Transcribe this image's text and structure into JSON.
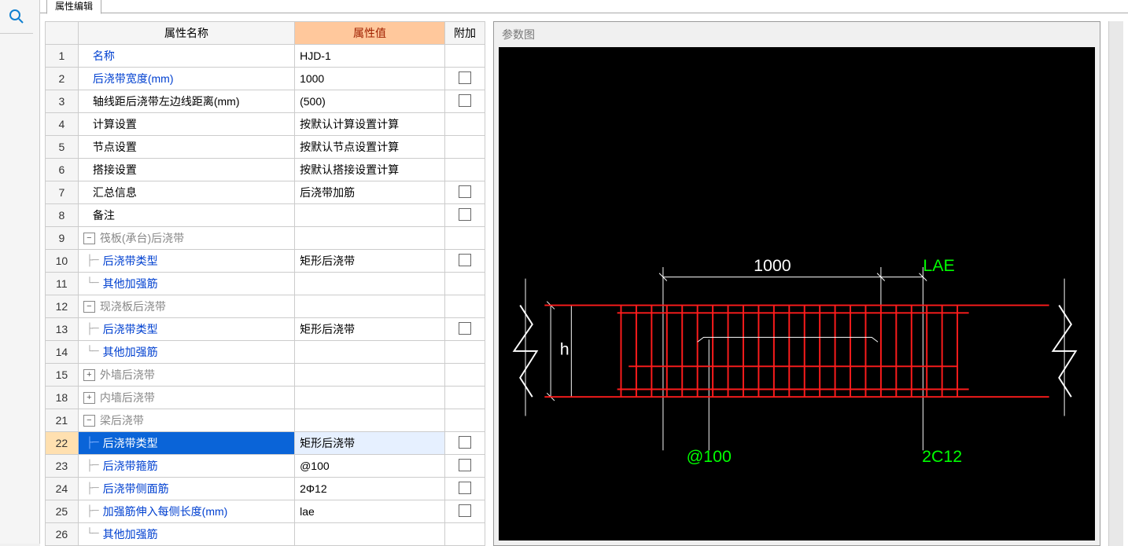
{
  "tab_title": "属性编辑",
  "headers": {
    "name": "属性名称",
    "value": "属性值",
    "extra": "附加"
  },
  "rows": [
    {
      "num": "1",
      "name": "名称",
      "value": "HJD-1",
      "link": true,
      "indent": 0,
      "checkbox": false
    },
    {
      "num": "2",
      "name": "后浇带宽度(mm)",
      "value": "1000",
      "link": true,
      "indent": 0,
      "checkbox": true
    },
    {
      "num": "3",
      "name": "轴线距后浇带左边线距离(mm)",
      "value": "(500)",
      "link": false,
      "indent": 0,
      "checkbox": true
    },
    {
      "num": "4",
      "name": "计算设置",
      "value": "按默认计算设置计算",
      "link": false,
      "indent": 0,
      "checkbox": false
    },
    {
      "num": "5",
      "name": "节点设置",
      "value": "按默认节点设置计算",
      "link": false,
      "indent": 0,
      "checkbox": false
    },
    {
      "num": "6",
      "name": "搭接设置",
      "value": "按默认搭接设置计算",
      "link": false,
      "indent": 0,
      "checkbox": false
    },
    {
      "num": "7",
      "name": "汇总信息",
      "value": "后浇带加筋",
      "link": false,
      "indent": 0,
      "checkbox": true
    },
    {
      "num": "8",
      "name": "备注",
      "value": "",
      "link": false,
      "indent": 0,
      "checkbox": true
    },
    {
      "num": "9",
      "name": "筏板(承台)后浇带",
      "value": "",
      "group": true,
      "toggle": "-",
      "gray": true
    },
    {
      "num": "10",
      "name": "后浇带类型",
      "value": "矩形后浇带",
      "link": true,
      "indent": 2,
      "checkbox": true,
      "child": true
    },
    {
      "num": "11",
      "name": "其他加强筋",
      "value": "",
      "link": true,
      "indent": 2,
      "checkbox": false,
      "child": true,
      "last": true
    },
    {
      "num": "12",
      "name": "现浇板后浇带",
      "value": "",
      "group": true,
      "toggle": "-",
      "gray": true
    },
    {
      "num": "13",
      "name": "后浇带类型",
      "value": "矩形后浇带",
      "link": true,
      "indent": 2,
      "checkbox": true,
      "child": true
    },
    {
      "num": "14",
      "name": "其他加强筋",
      "value": "",
      "link": true,
      "indent": 2,
      "checkbox": false,
      "child": true,
      "last": true
    },
    {
      "num": "15",
      "name": "外墙后浇带",
      "value": "",
      "group": true,
      "toggle": "+",
      "gray": true
    },
    {
      "num": "18",
      "name": "内墙后浇带",
      "value": "",
      "group": true,
      "toggle": "+",
      "gray": true
    },
    {
      "num": "21",
      "name": "梁后浇带",
      "value": "",
      "group": true,
      "toggle": "-",
      "gray": true
    },
    {
      "num": "22",
      "name": "后浇带类型",
      "value": "矩形后浇带",
      "link": true,
      "indent": 2,
      "checkbox": true,
      "child": true,
      "selected": true
    },
    {
      "num": "23",
      "name": "后浇带箍筋",
      "value": "@100",
      "link": true,
      "indent": 2,
      "checkbox": true,
      "child": true
    },
    {
      "num": "24",
      "name": "后浇带侧面筋",
      "value": "2Φ12",
      "link": true,
      "indent": 2,
      "checkbox": true,
      "child": true
    },
    {
      "num": "25",
      "name": "加强筋伸入每侧长度(mm)",
      "value": "lae",
      "link": true,
      "indent": 2,
      "checkbox": true,
      "child": true
    },
    {
      "num": "26",
      "name": "其他加强筋",
      "value": "",
      "link": true,
      "indent": 2,
      "checkbox": false,
      "child": true,
      "last": true
    }
  ],
  "diagram": {
    "title": "参数图",
    "dim_top": "1000",
    "label_lae": "LAE",
    "label_h": "h",
    "label_spacing": "@100",
    "label_bars": "2C12"
  }
}
